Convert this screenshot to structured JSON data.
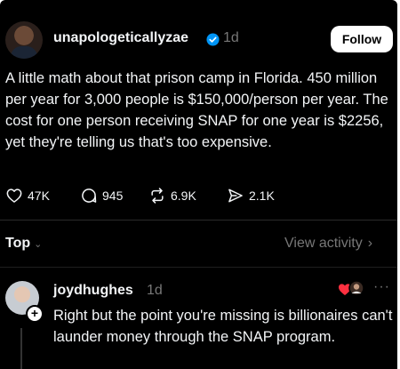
{
  "post": {
    "username": "unapologeticallyzae",
    "time": "1d",
    "follow_label": "Follow",
    "text": "A little math about that prison camp in Florida. 450 million per year for 3,000 people is $150,000/person per year. The cost for one person receiving SNAP for one year is $2256, yet they're telling us that's too expensive.",
    "likes": "47K",
    "comments": "945",
    "reposts": "6.9K",
    "shares": "2.1K"
  },
  "replies_bar": {
    "sort_label": "Top",
    "view_activity_label": "View activity"
  },
  "reply": {
    "username": "joydhughes",
    "time": "1d",
    "more": "···",
    "text": "Right but the point you're missing is billionaires can't launder money through the SNAP program."
  },
  "colors": {
    "background": "#000000",
    "text": "#f3f5f7",
    "muted": "#777777",
    "verified": "#0095f6",
    "like_heart": "#ff3040"
  },
  "icons": [
    "verified-badge-icon",
    "heart-icon",
    "comment-icon",
    "repost-icon",
    "share-icon",
    "chevron-down-icon",
    "chevron-right-icon",
    "plus-icon",
    "more-icon"
  ]
}
